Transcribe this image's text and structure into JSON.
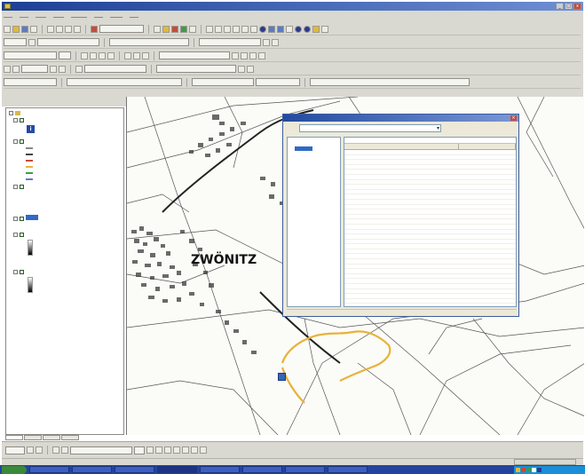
{
  "window": {
    "title": ""
  },
  "colors": {
    "route": "#e8b23a",
    "selection": "#316ac5",
    "titlebar": "#1b3f96",
    "taskbar": "#24439e",
    "start": "#3b8a3b"
  },
  "toc": {
    "info_icon": "info-icon",
    "zoom_label": "",
    "items": [
      {
        "id": "layers",
        "label": "",
        "level": 0
      },
      {
        "id": "g1",
        "label": "",
        "level": 1
      },
      {
        "id": "g2",
        "label": "",
        "level": 1
      },
      {
        "id": "g2a",
        "label": "",
        "level": 2
      },
      {
        "id": "g2b",
        "label": "",
        "level": 2
      },
      {
        "id": "g2c",
        "label": "",
        "level": 2
      }
    ]
  },
  "tabs": [
    "",
    "",
    "",
    ""
  ],
  "map": {
    "place_label": "ZWÖNITZ",
    "route_color": "#e8b23a",
    "north_marker_icon": "point-marker-icon"
  },
  "identify_dialog": {
    "title": "",
    "layers_label": "",
    "layers_value": "",
    "tree": [
      "",
      ""
    ],
    "location": "",
    "columns": [
      "",
      ""
    ],
    "rows": [],
    "status": ""
  },
  "statusbar": {
    "left": "",
    "right": ""
  },
  "taskbar": {
    "start_label": "",
    "tasks": [
      "",
      "",
      "",
      "",
      "",
      "",
      "",
      ""
    ]
  }
}
